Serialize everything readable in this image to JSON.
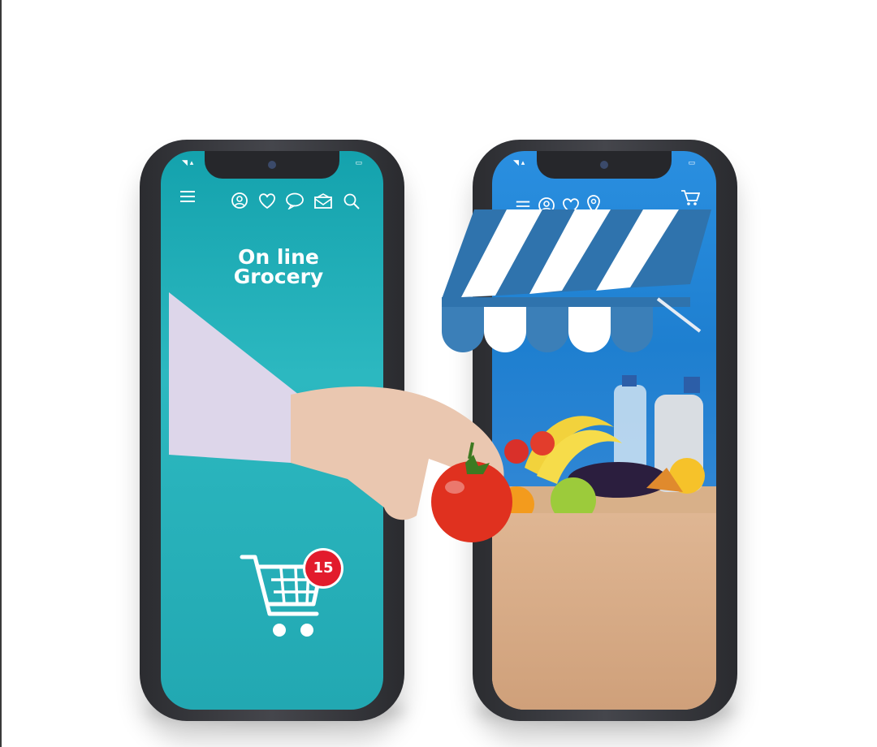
{
  "left_screen": {
    "title_line1": "On line",
    "title_line2": "Grocery",
    "cart_badge_count": "15",
    "nav_icons": [
      "menu-icon",
      "user-icon",
      "heart-icon",
      "chat-icon",
      "mail-icon",
      "search-icon"
    ],
    "background_color": "#1aa9b3"
  },
  "right_screen": {
    "nav_icons": [
      "menu-icon",
      "user-icon",
      "heart-icon",
      "location-icon",
      "cart-icon"
    ],
    "background_color": "#1e7fd0",
    "awning_colors": [
      "#2f73ad",
      "#ffffff"
    ]
  },
  "accent_colors": {
    "badge": "#e21b2c",
    "phone_body": "#2d2e33",
    "paper_bag": "#d9b08c",
    "tomato": "#e33a22"
  }
}
